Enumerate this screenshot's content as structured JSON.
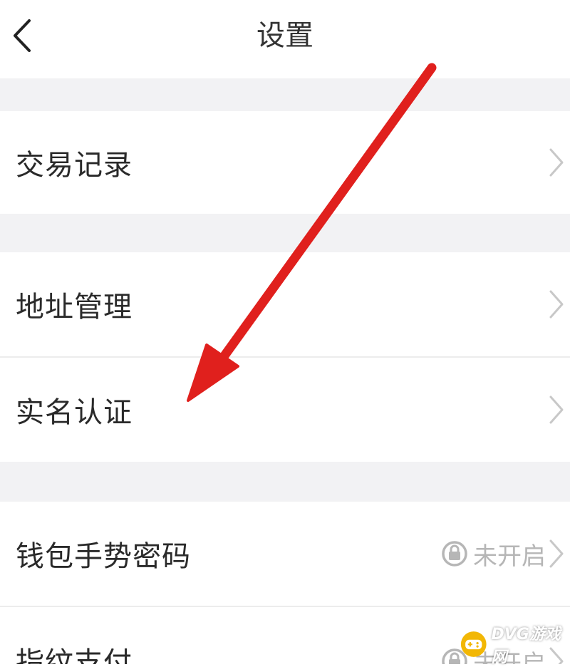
{
  "header": {
    "title": "设置",
    "back_icon": "chevron-left-icon"
  },
  "rows": [
    {
      "label": "交易记录"
    },
    {
      "label": "地址管理"
    },
    {
      "label": "实名认证"
    },
    {
      "label": "钱包手势密码",
      "status": "未开启",
      "status_icon": "lock-icon"
    },
    {
      "label": "指纹支付",
      "status": "未开启",
      "status_icon": "lock-icon"
    }
  ],
  "annotation": {
    "type": "red-arrow",
    "color": "#e0201d",
    "points_to": "实名认证"
  },
  "watermark": {
    "text": "DVG游戏网",
    "accent": "#f2b705"
  },
  "colors": {
    "background": "#ffffff",
    "section_gap": "#f2f2f4",
    "text": "#2a2a2a",
    "muted": "#b6b6b6",
    "chevron": "#c8c8c8"
  }
}
